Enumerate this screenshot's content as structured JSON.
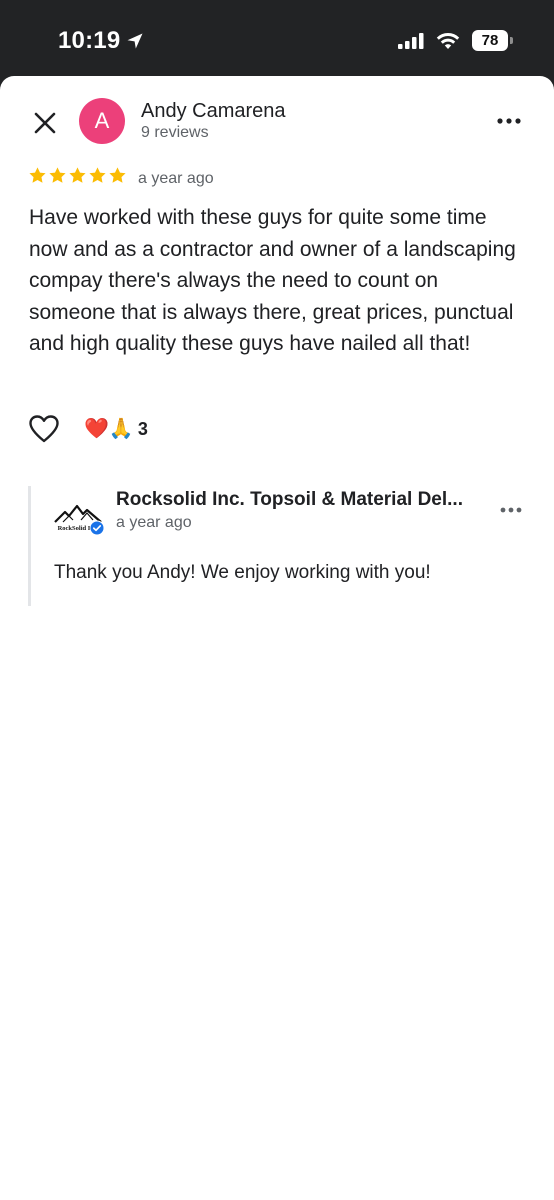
{
  "status_bar": {
    "time": "10:19",
    "battery": "78"
  },
  "review": {
    "avatar_letter": "A",
    "avatar_color": "#ec407a",
    "reviewer_name": "Andy Camarena",
    "reviewer_reviews": "9 reviews",
    "rating": 5,
    "star_color": "#fbbc04",
    "time": "a year ago",
    "text": "Have worked with these guys for quite some time now and as a contractor and owner of a landscaping compay there's always the need to count on someone that is always there, great prices, punctual and high quality these guys have nailed all that!",
    "reactions": {
      "emojis": "❤️🙏",
      "count": "3"
    }
  },
  "owner_reply": {
    "logo_text": "RockSolid Inc.",
    "name": "Rocksolid Inc. Topsoil & Material Del...",
    "time": "a year ago",
    "text": "Thank you Andy! We enjoy working with you!",
    "verified_color": "#1a73e8"
  },
  "icons": {
    "close": "close-icon",
    "more": "more-horiz-icon",
    "like": "heart-outline-icon",
    "location": "location-arrow-icon",
    "signal": "cellular-signal-icon",
    "wifi": "wifi-icon",
    "verified": "verified-badge-icon"
  }
}
